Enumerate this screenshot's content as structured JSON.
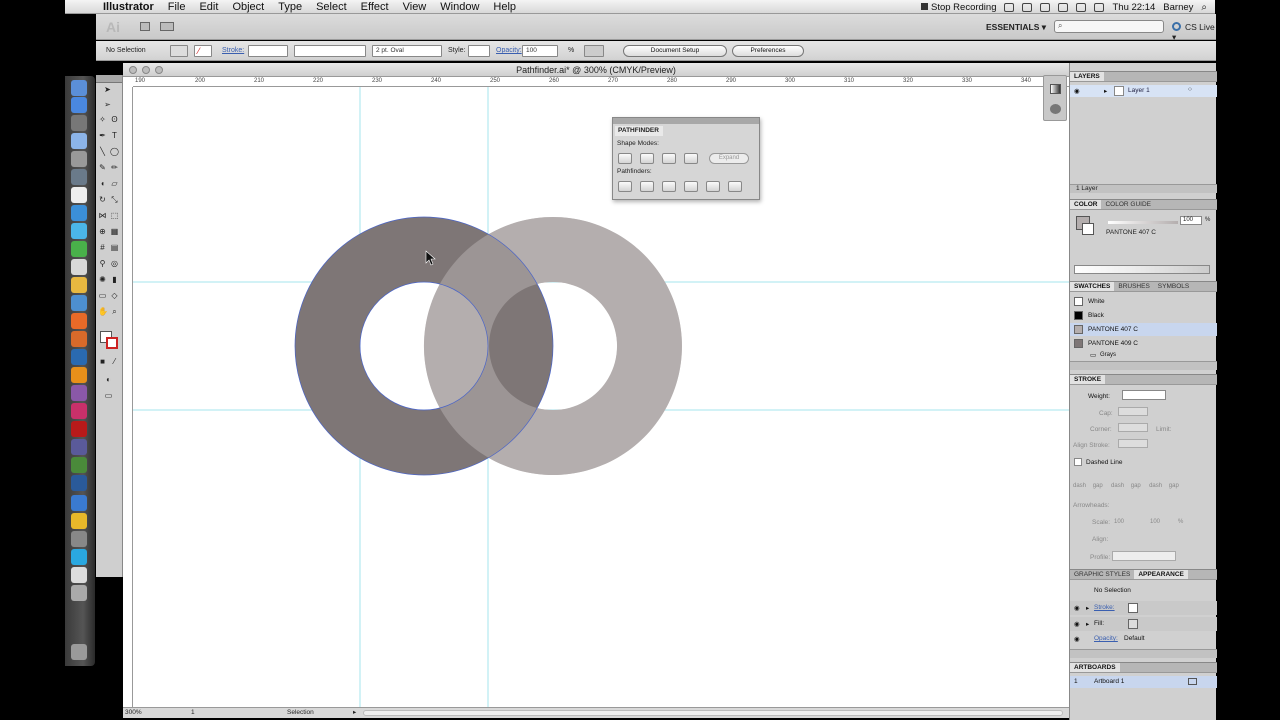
{
  "menubar": {
    "app": "Illustrator",
    "items": [
      "File",
      "Edit",
      "Object",
      "Type",
      "Select",
      "Effect",
      "View",
      "Window",
      "Help"
    ],
    "recording": "Stop Recording",
    "clock": "Thu 22:14",
    "user": "Barney"
  },
  "appbar": {
    "logo": "Ai",
    "workspace": "ESSENTIALS ▾",
    "cslive": "CS Live ▾"
  },
  "control": {
    "selection": "No Selection",
    "stroke_label": "Stroke:",
    "brush": "2 pt. Oval",
    "style_label": "Style:",
    "opacity_label": "Opacity:",
    "opacity_value": "100",
    "opacity_unit": "%",
    "doc_setup": "Document Setup",
    "preferences": "Preferences"
  },
  "document": {
    "title": "Pathfinder.ai* @ 300% (CMYK/Preview)",
    "zoom": "300%",
    "artboard_num": "1",
    "status": "Selection",
    "hruler_ticks": [
      "190",
      "200",
      "210",
      "220",
      "230",
      "240",
      "250",
      "260",
      "270",
      "280",
      "290",
      "300",
      "310",
      "320",
      "330",
      "340"
    ]
  },
  "pathfinder": {
    "title": "PATHFINDER",
    "shape_modes": "Shape Modes:",
    "pathfinders": "Pathfinders:",
    "expand": "Expand"
  },
  "layers": {
    "tab": "LAYERS",
    "layer1": "Layer 1",
    "count": "1 Layer"
  },
  "color": {
    "tabs": [
      "COLOR",
      "COLOR GUIDE"
    ],
    "tint": "100",
    "tint_unit": "%",
    "swatch_name": "PANTONE 407 C"
  },
  "swatches": {
    "tabs": [
      "SWATCHES",
      "BRUSHES",
      "SYMBOLS"
    ],
    "items": [
      "White",
      "Black",
      "PANTONE 407 C",
      "PANTONE 409 C"
    ],
    "group": "Grays",
    "colors": [
      "#ffffff",
      "#000000",
      "#b4aeae",
      "#7e7676"
    ]
  },
  "stroke": {
    "tab": "STROKE",
    "weight": "Weight:",
    "cap": "Cap:",
    "corner": "Corner:",
    "limit": "Limit:",
    "align": "Align Stroke:",
    "dashed": "Dashed Line",
    "dash_labels": [
      "dash",
      "gap",
      "dash",
      "gap",
      "dash",
      "gap"
    ],
    "arrowheads": "Arrowheads:",
    "scale": "Scale:",
    "scale_v1": "100",
    "scale_v2": "100",
    "scale_unit": "%",
    "align2": "Align:",
    "profile": "Profile:"
  },
  "appearance": {
    "tabs": [
      "GRAPHIC STYLES",
      "APPEARANCE"
    ],
    "selection": "No Selection",
    "stroke": "Stroke:",
    "fill": "Fill:",
    "opacity": "Opacity:",
    "opacity_value": "Default"
  },
  "artboards": {
    "tab": "ARTBOARDS",
    "num": "1",
    "name": "Artboard 1"
  },
  "colors": {
    "ring_light": "#b4aeae",
    "ring_dark": "#7e7676",
    "guide": "#a6e4ee",
    "selection_path": "#4a64c8"
  }
}
